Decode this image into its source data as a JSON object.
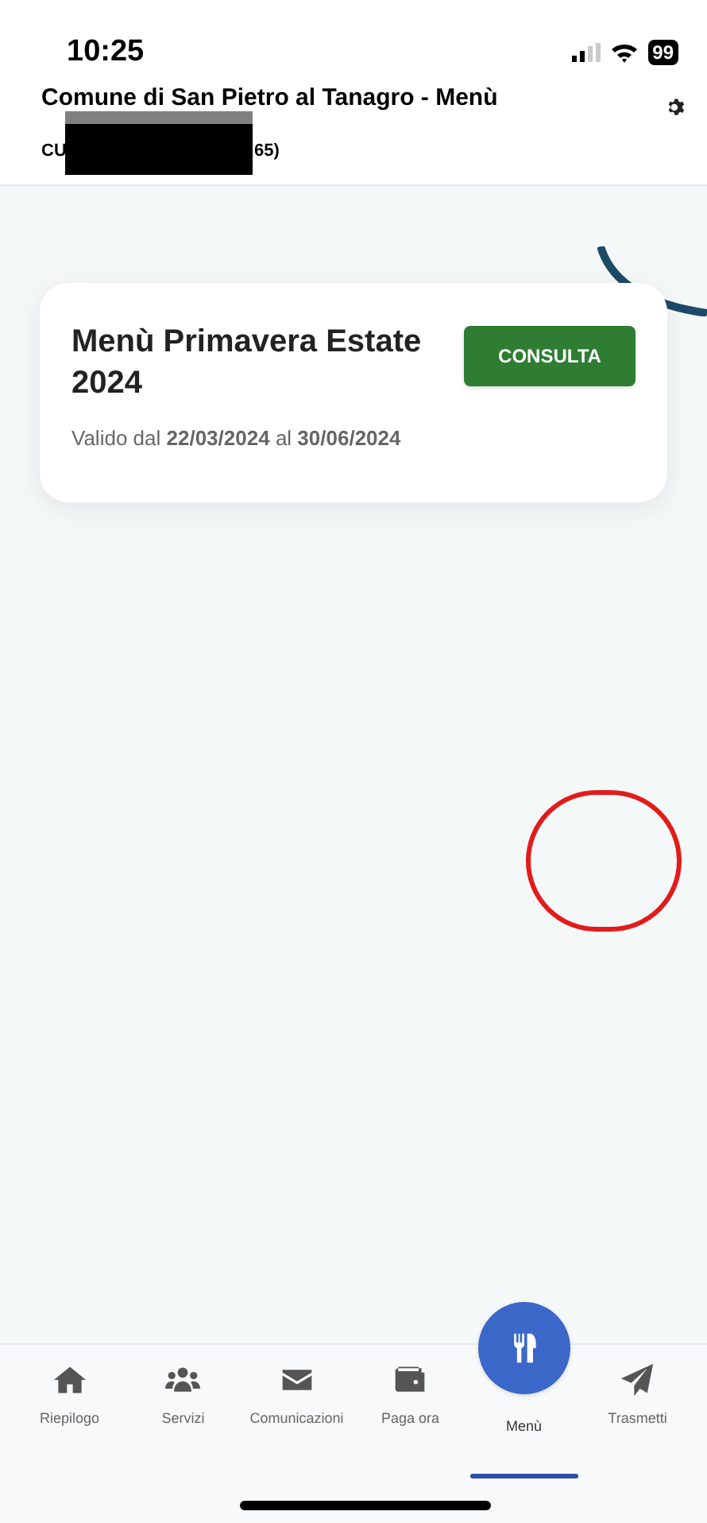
{
  "status_bar": {
    "time": "10:25",
    "battery": "99"
  },
  "header": {
    "title": "Comune di San Pietro al Tanagro - Menù",
    "subtitle_start": "CU",
    "subtitle_end": "65)"
  },
  "menu_card": {
    "title": "Menù Primavera Estate 2024",
    "validity": "Valido dal **22/03/2024** al **30/06/2024**",
    "button": "CONSULTA"
  },
  "nav": [
    {
      "kind": "home",
      "label": "Riepilogo",
      "selected": false
    },
    {
      "kind": "users",
      "label": "Servizi",
      "selected": false
    },
    {
      "kind": "mail",
      "label": "Comunicazioni",
      "selected": false
    },
    {
      "kind": "wallet",
      "label": "Paga ora",
      "selected": false
    },
    {
      "kind": "cutlery",
      "label": "Menù",
      "selected": true
    },
    {
      "kind": "send",
      "label": "Trasmetti",
      "selected": false
    }
  ]
}
